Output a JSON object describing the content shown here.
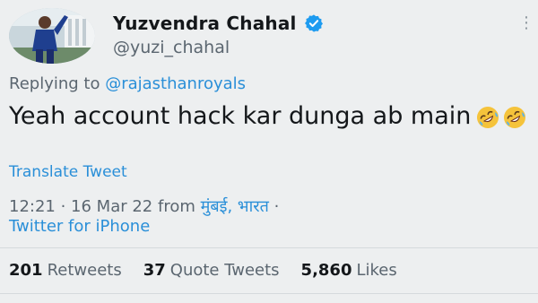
{
  "author": {
    "display_name": "Yuzvendra Chahal",
    "handle": "@yuzi_chahal",
    "verified_icon": "verified-badge-icon",
    "verified_color": "#1d9bf0"
  },
  "menu": {
    "more_icon": "more-vertical-icon",
    "glyph": "⋮"
  },
  "reply": {
    "prefix": "Replying to ",
    "mention": "@rajasthanroyals"
  },
  "tweet": {
    "text": "Yeah account hack kar dunga ab main",
    "emojis": [
      "rolling-on-floor-laughing-icon",
      "rolling-on-floor-laughing-icon"
    ],
    "translate_label": "Translate Tweet"
  },
  "meta": {
    "time": "12:21",
    "separator": " · ",
    "date": "16 Mar 22",
    "from_label": " from ",
    "location": "मुंबई, भारत",
    "trailing_separator": " ·",
    "source": "Twitter for iPhone"
  },
  "stats": [
    {
      "count": "201",
      "label": "Retweets"
    },
    {
      "count": "37",
      "label": "Quote Tweets"
    },
    {
      "count": "5,860",
      "label": "Likes"
    }
  ],
  "colors": {
    "link": "#2a8fd8",
    "secondary_text": "#5b6670",
    "primary_text": "#14171a"
  }
}
